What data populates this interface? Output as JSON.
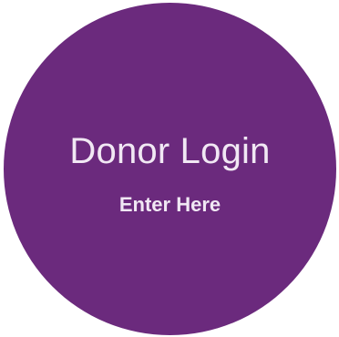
{
  "colors": {
    "circle_fill": "#6b2a7d",
    "text": "#f1e8f4",
    "background": "#ffffff"
  },
  "login_badge": {
    "title": "Donor Login",
    "subtitle": "Enter Here"
  }
}
